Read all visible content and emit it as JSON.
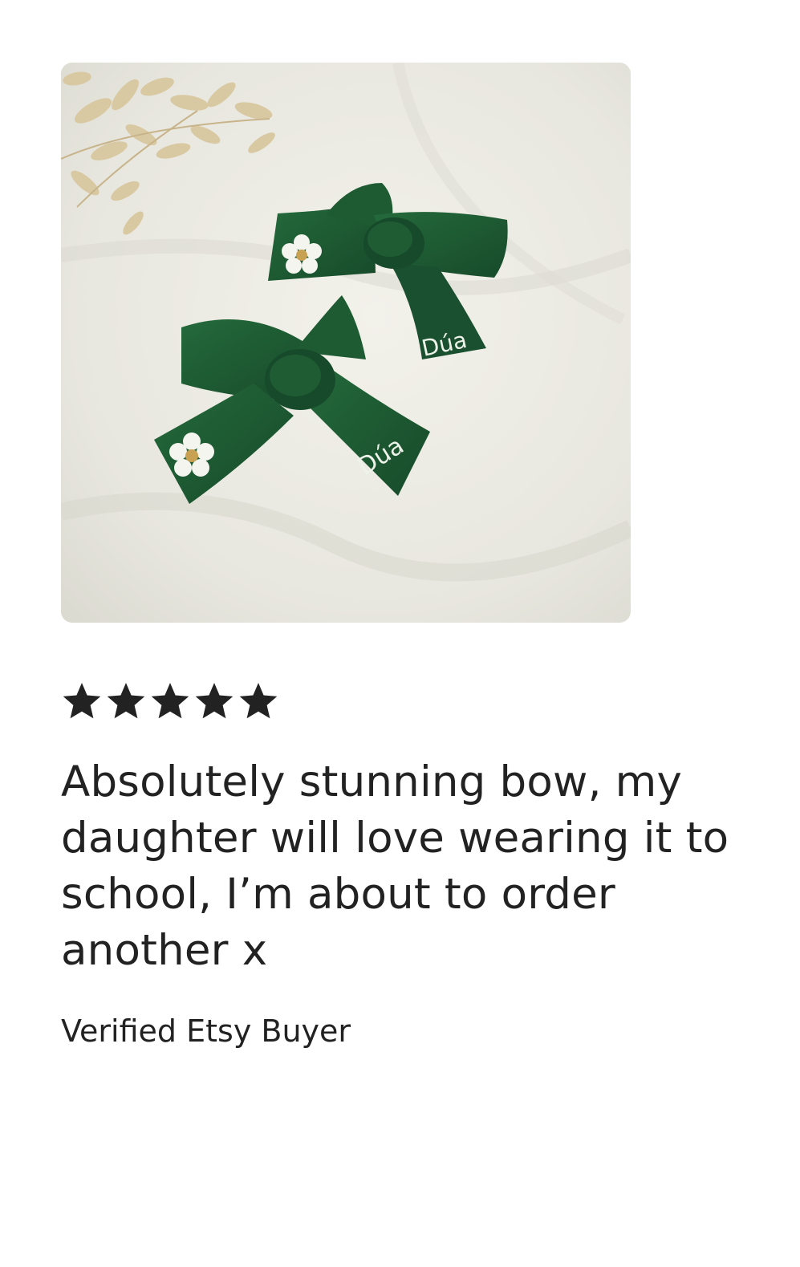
{
  "review": {
    "photo_alt": "Green hair bows",
    "rating": 5,
    "rating_max": 5,
    "star_color": "#222222",
    "text": "Absolutely stunning bow, my daughter will love wearing it to school, I’m about to order another x",
    "reviewer": "Verified Etsy Buyer",
    "embroidery_name": "Dúa"
  },
  "colors": {
    "bow_green": "#1e5a32",
    "bow_shadow": "#154527",
    "fabric": "#ecebe4",
    "dried_flowers": "#d9c8a0",
    "text": "#222222"
  }
}
